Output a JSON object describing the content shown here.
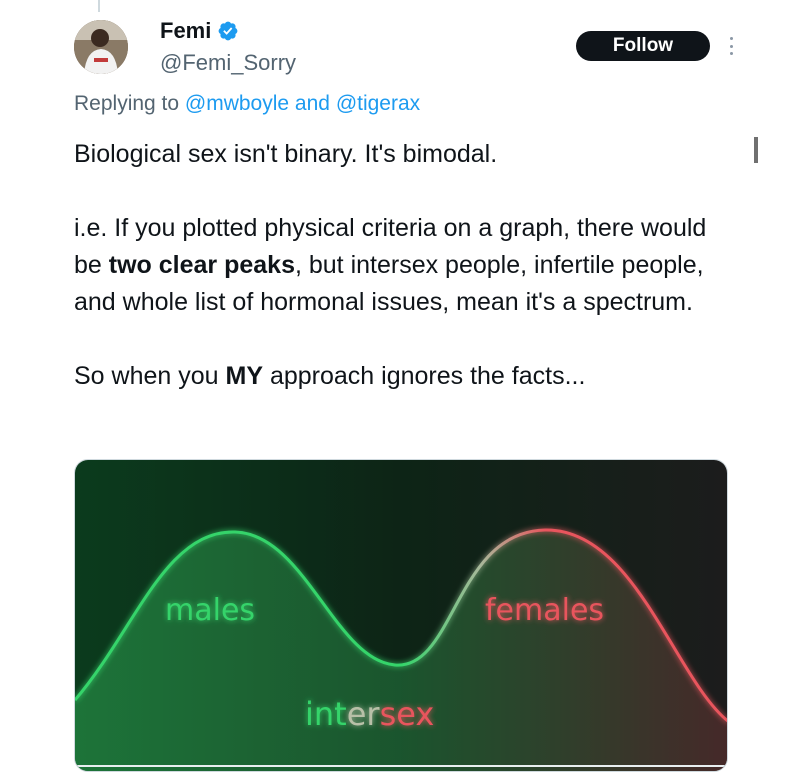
{
  "tweet": {
    "author": {
      "display_name": "Femi",
      "handle": "@Femi_Sorry",
      "verified": true
    },
    "follow_label": "Follow",
    "reply": {
      "prefix": "Replying to ",
      "mention1": "@mwboyle",
      "joiner": " and ",
      "mention2": "@tigerax"
    },
    "body": {
      "line1": "Biological sex isn't binary. It's bimodal.",
      "p2_start": "i.e. If you plotted physical criteria on a graph, there would be ",
      "p2_bold": "two clear peaks",
      "p2_end": ", but intersex people, infertile people, and whole list of hormonal issues, mean it's a spectrum.",
      "p3_start": "So when you ",
      "p3_bold": "MY",
      "p3_end": " approach ignores the facts..."
    },
    "media": {
      "label_males": "males",
      "label_females": "females",
      "label_inter_a": "int",
      "label_inter_b": "er",
      "label_inter_c": "sex",
      "colors": {
        "male": "#35d46b",
        "female": "#e8555d",
        "background": "#0e2a18"
      }
    }
  },
  "colors": {
    "accent": "#1d9bf0",
    "text": "#0f1419",
    "secondary_text": "#536471"
  }
}
